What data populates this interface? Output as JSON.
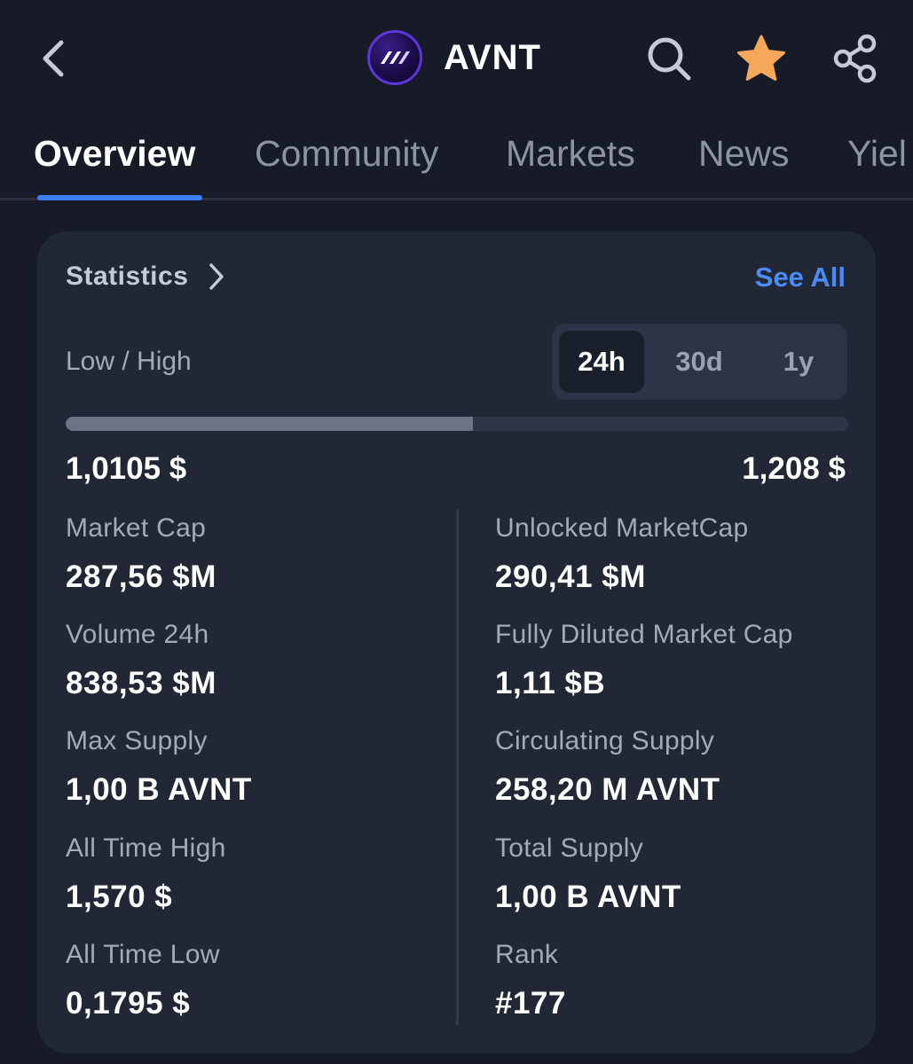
{
  "header": {
    "coin_name": "AVNT",
    "icons": {
      "back": "chevron-left-icon",
      "search": "search-icon",
      "favorite": "star-icon",
      "share": "share-icon"
    },
    "colors": {
      "star": "#f5a75a",
      "logo_ring": "#5b36d9"
    }
  },
  "tabs": [
    {
      "label": "Overview",
      "active": true
    },
    {
      "label": "Community",
      "active": false
    },
    {
      "label": "Markets",
      "active": false
    },
    {
      "label": "News",
      "active": false
    },
    {
      "label": "Yiel",
      "active": false
    }
  ],
  "statistics": {
    "title": "Statistics",
    "see_all": "See All",
    "low_high_label": "Low / High",
    "periods": [
      {
        "label": "24h",
        "active": true
      },
      {
        "label": "30d",
        "active": false
      },
      {
        "label": "1y",
        "active": false
      }
    ],
    "range": {
      "low": "1,0105 $",
      "high": "1,208 $",
      "position_fraction": 0.52
    },
    "left_metrics": [
      {
        "label": "Market Cap",
        "value": "287,56 $M"
      },
      {
        "label": "Volume 24h",
        "value": "838,53 $M"
      },
      {
        "label": "Max Supply",
        "value": "1,00 B AVNT"
      },
      {
        "label": "All Time High",
        "value": "1,570 $"
      },
      {
        "label": "All Time Low",
        "value": "0,1795 $"
      }
    ],
    "right_metrics": [
      {
        "label": "Unlocked MarketCap",
        "value": "290,41 $M"
      },
      {
        "label": "Fully Diluted Market Cap",
        "value": "1,11 $B"
      },
      {
        "label": "Circulating Supply",
        "value": "258,20 M AVNT"
      },
      {
        "label": "Total Supply",
        "value": "1,00 B AVNT"
      },
      {
        "label": "Rank",
        "value": "#177"
      }
    ],
    "colors": {
      "accent": "#4b8bf5",
      "tab_indicator": "#3d7ef5"
    }
  }
}
